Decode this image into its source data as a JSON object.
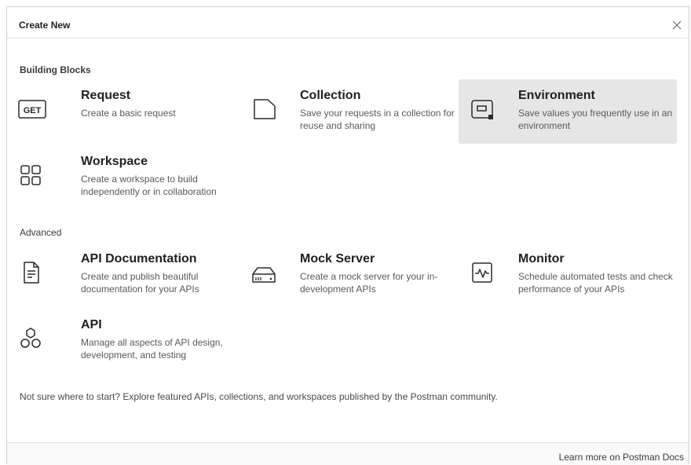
{
  "modal": {
    "title": "Create New",
    "sections": {
      "building_blocks": "Building Blocks",
      "advanced": "Advanced"
    },
    "building_blocks": [
      {
        "title": "Request",
        "desc": "Create a basic request",
        "icon": "get-icon",
        "icon_text": "GET"
      },
      {
        "title": "Collection",
        "desc": "Save your requests in a collection for reuse and sharing",
        "icon": "collection-folder-icon"
      },
      {
        "title": "Environment",
        "desc": "Save values you frequently use in an environment",
        "icon": "environment-icon",
        "selected": true
      },
      {
        "title": "Workspace",
        "desc": "Create a workspace to build independently or in collaboration",
        "icon": "workspace-grid-icon"
      }
    ],
    "advanced": [
      {
        "title": "API Documentation",
        "desc": "Create and publish beautiful documentation for your APIs",
        "icon": "document-icon"
      },
      {
        "title": "Mock Server",
        "desc": "Create a mock server for your in-development APIs",
        "icon": "server-icon"
      },
      {
        "title": "Monitor",
        "desc": "Schedule automated tests and check performance of your APIs",
        "icon": "monitor-pulse-icon"
      },
      {
        "title": "API",
        "desc": "Manage all aspects of API design, development, and testing",
        "icon": "api-hexagons-icon"
      }
    ],
    "footer_text": "Not sure where to start? Explore featured APIs, collections, and workspaces published by the Postman community.",
    "docs_link": "Learn more on Postman Docs",
    "colors": {
      "selected_bg": "#e6e6e6",
      "border": "#cfcfcf",
      "text_primary": "#212121",
      "text_secondary": "#5a5a5a"
    }
  }
}
